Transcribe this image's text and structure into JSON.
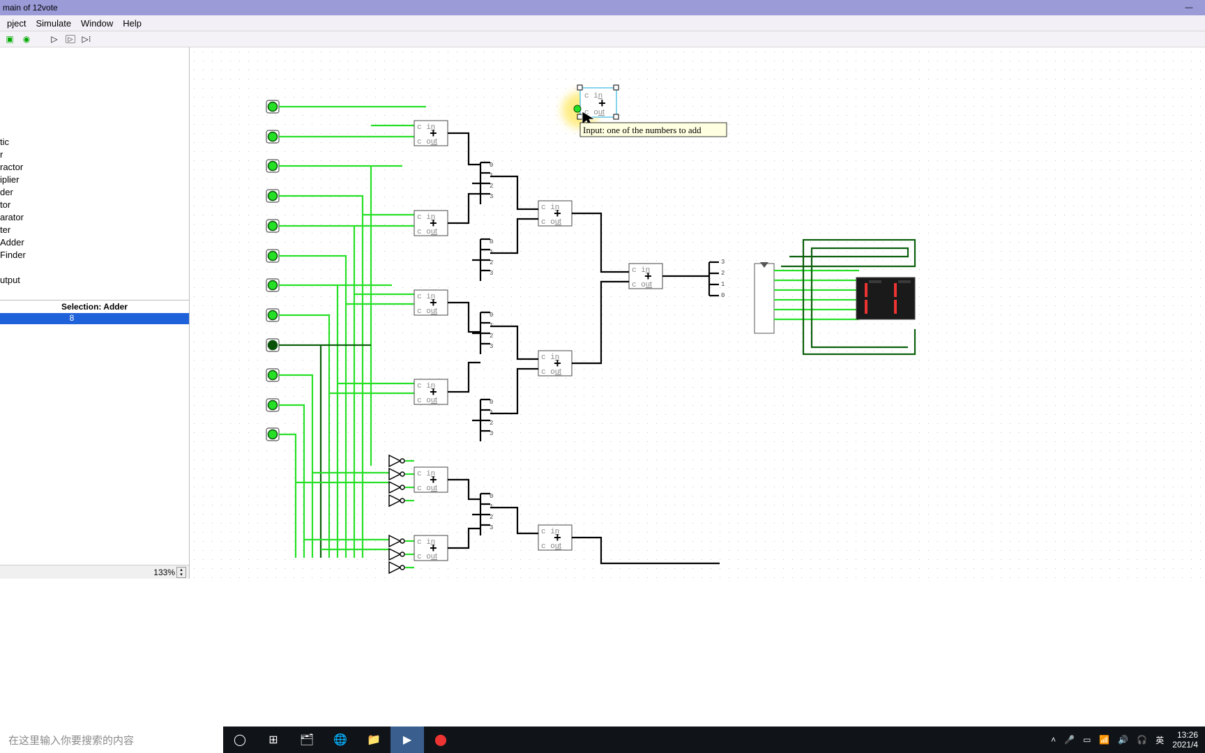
{
  "window": {
    "title": "main of 12vote"
  },
  "menu": {
    "project": "pject",
    "simulate": "Simulate",
    "window": "Window",
    "help": "Help"
  },
  "tree": {
    "items": [
      "tic",
      "r",
      "ractor",
      "iplier",
      "der",
      "tor",
      "arator",
      "ter",
      "Adder",
      "Finder",
      "",
      "utput"
    ]
  },
  "props": {
    "header": "Selection: Adder",
    "row1_key": "",
    "row1_val": "8"
  },
  "zoom": {
    "value": "133%"
  },
  "canvas": {
    "adder_label_top": "c in",
    "adder_label_bot": "c out",
    "split_labels": [
      "0",
      "1",
      "2",
      "3"
    ],
    "tooltip": "Input: one of the numbers to add"
  },
  "taskbar": {
    "search_placeholder": "在这里输入你要搜索的内容",
    "ime": "英",
    "clock_line1": "13:26",
    "clock_line2": "2021/4"
  }
}
